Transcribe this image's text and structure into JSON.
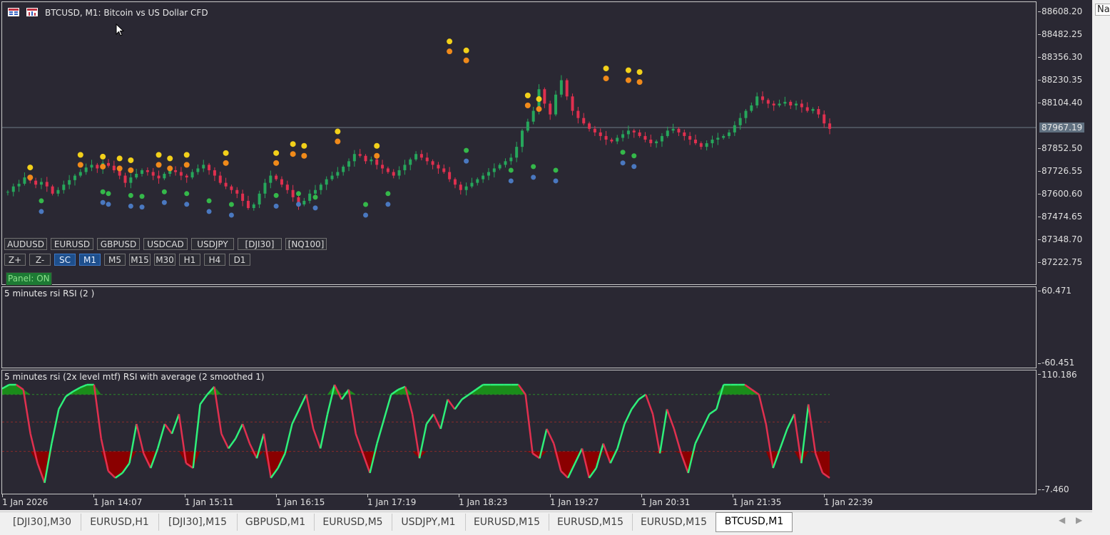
{
  "window": {
    "title": "BTCUSD, M1:  Bitcoin vs US Dollar CFD"
  },
  "colors": {
    "background": "#2a2833",
    "bull": "#26a65b",
    "bear": "#e0304f",
    "rsi_up": "#2ef07a",
    "rsi_down": "#e0304f",
    "fill_up": "#1a8c1a",
    "fill_down": "#8a0000"
  },
  "price_axis": {
    "ticks": [
      "88608.20",
      "88482.25",
      "88356.30",
      "88230.35",
      "88104.40",
      "87852.50",
      "87726.55",
      "87600.60",
      "87474.65",
      "87348.70",
      "87222.75"
    ],
    "current": "87967.19"
  },
  "time_axis": {
    "ticks": [
      "1 Jan 2026",
      "1 Jan 14:07",
      "1 Jan 15:11",
      "1 Jan 16:15",
      "1 Jan 17:19",
      "1 Jan 18:23",
      "1 Jan 19:27",
      "1 Jan 20:31",
      "1 Jan 21:35",
      "1 Jan 22:39"
    ]
  },
  "symbol_buttons": [
    "AUDUSD",
    "EURUSD",
    "GBPUSD",
    "USDCAD",
    "USDJPY",
    "[DJI30]",
    "[NQ100]"
  ],
  "tool_buttons": [
    "Z+",
    "Z-",
    "SC",
    "M1",
    "M5",
    "M15",
    "M30",
    "H1",
    "H4",
    "D1"
  ],
  "active_tool_buttons": [
    "SC",
    "M1"
  ],
  "panel_status": "Panel: ON",
  "rsi1": {
    "title": "5 minutes rsi RSI (2 )",
    "max": "60.471",
    "min": "-60.451"
  },
  "rsi2": {
    "title": "5 minutes rsi (2x level mtf) RSI with average (2 smoothed 1)",
    "max": "110.186",
    "min": "-7.460"
  },
  "tabs": [
    "[DJI30],M30",
    "EURUSD,H1",
    "[DJI30],M15",
    "GBPUSD,M1",
    "EURUSD,M5",
    "USDJPY,M1",
    "EURUSD,M15",
    "EURUSD,M15",
    "EURUSD,M15",
    "BTCUSD,M1"
  ],
  "active_tab": "BTCUSD,M1",
  "side_panel": {
    "label": "Na"
  },
  "chart_data": {
    "type": "candlestick",
    "title": "BTCUSD, M1:  Bitcoin vs US Dollar CFD",
    "ylim": [
      87160,
      88640
    ],
    "closes": [
      87610,
      87640,
      87655,
      87690,
      87672,
      87650,
      87665,
      87640,
      87600,
      87620,
      87650,
      87675,
      87700,
      87720,
      87745,
      87760,
      87740,
      87770,
      87755,
      87730,
      87700,
      87660,
      87690,
      87710,
      87730,
      87720,
      87700,
      87685,
      87710,
      87730,
      87720,
      87700,
      87690,
      87720,
      87740,
      87760,
      87730,
      87700,
      87660,
      87640,
      87620,
      87600,
      87560,
      87520,
      87540,
      87600,
      87660,
      87700,
      87680,
      87650,
      87620,
      87580,
      87540,
      87560,
      87600,
      87620,
      87650,
      87680,
      87700,
      87720,
      87750,
      87780,
      87820,
      87810,
      87780,
      87790,
      87760,
      87740,
      87720,
      87700,
      87730,
      87760,
      87790,
      87820,
      87800,
      87780,
      87760,
      87740,
      87720,
      87680,
      87650,
      87620,
      87640,
      87660,
      87680,
      87700,
      87720,
      87740,
      87760,
      87780,
      87800,
      87860,
      87950,
      88000,
      88060,
      88180,
      88100,
      88040,
      88150,
      88230,
      88140,
      88060,
      88020,
      87990,
      87960,
      87940,
      87920,
      87900,
      87890,
      87910,
      87930,
      87950,
      87940,
      87920,
      87900,
      87880,
      87890,
      87920,
      87950,
      87960,
      87940,
      87920,
      87900,
      87880,
      87860,
      87880,
      87900,
      87910,
      87920,
      87940,
      87980,
      88020,
      88060,
      88090,
      88140,
      88120,
      88100,
      88090,
      88100,
      88110,
      88090,
      88100,
      88080,
      88060,
      88070,
      88040,
      87990,
      87960
    ],
    "signals_up": [
      [
        6,
        87560
      ],
      [
        17,
        87610
      ],
      [
        18,
        87600
      ],
      [
        22,
        87590
      ],
      [
        24,
        87585
      ],
      [
        28,
        87610
      ],
      [
        32,
        87600
      ],
      [
        36,
        87560
      ],
      [
        40,
        87540
      ],
      [
        48,
        87590
      ],
      [
        52,
        87600
      ],
      [
        55,
        87580
      ],
      [
        64,
        87540
      ],
      [
        68,
        87600
      ],
      [
        82,
        87840
      ],
      [
        90,
        87730
      ],
      [
        94,
        87750
      ],
      [
        98,
        87730
      ],
      [
        110,
        87830
      ],
      [
        112,
        87810
      ]
    ],
    "signals_down": [
      [
        4,
        87690
      ],
      [
        13,
        87760
      ],
      [
        17,
        87750
      ],
      [
        20,
        87740
      ],
      [
        22,
        87730
      ],
      [
        27,
        87760
      ],
      [
        29,
        87740
      ],
      [
        32,
        87760
      ],
      [
        39,
        87770
      ],
      [
        48,
        87770
      ],
      [
        51,
        87820
      ],
      [
        53,
        87810
      ],
      [
        59,
        87890
      ],
      [
        66,
        87810
      ],
      [
        79,
        88390
      ],
      [
        82,
        88340
      ],
      [
        93,
        88090
      ],
      [
        95,
        88070
      ],
      [
        107,
        88240
      ],
      [
        111,
        88230
      ],
      [
        113,
        88220
      ]
    ],
    "rsi2_values": [
      96,
      100,
      100,
      95,
      50,
      20,
      0,
      40,
      75,
      88,
      93,
      97,
      100,
      100,
      45,
      12,
      5,
      10,
      20,
      60,
      30,
      15,
      35,
      60,
      50,
      70,
      20,
      15,
      80,
      90,
      98,
      50,
      35,
      45,
      60,
      40,
      25,
      50,
      5,
      15,
      30,
      60,
      75,
      90,
      55,
      35,
      70,
      100,
      85,
      95,
      50,
      30,
      10,
      40,
      65,
      90,
      95,
      98,
      70,
      25,
      60,
      70,
      55,
      85,
      75,
      85,
      90,
      95,
      100,
      100,
      100,
      100,
      100,
      100,
      90,
      30,
      25,
      55,
      40,
      12,
      5,
      20,
      35,
      5,
      15,
      40,
      20,
      35,
      60,
      75,
      85,
      90,
      70,
      30,
      75,
      55,
      30,
      10,
      40,
      55,
      70,
      75,
      100,
      100,
      100,
      100,
      95,
      90,
      60,
      15,
      35,
      55,
      70,
      20,
      80,
      30,
      10,
      5
    ]
  }
}
